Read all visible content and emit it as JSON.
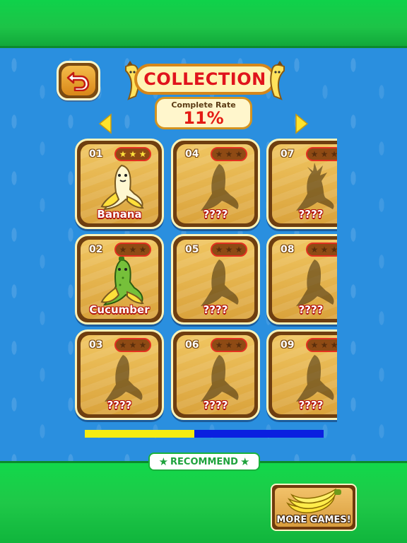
{
  "header": {
    "title": "COLLECTION",
    "back_icon": "back-arrow-icon"
  },
  "complete_rate": {
    "label": "Complete Rate",
    "value": "11%"
  },
  "navigation": {
    "prev_icon": "triangle-left-icon",
    "next_icon": "triangle-right-icon"
  },
  "collection": {
    "items": [
      {
        "number": "01",
        "name": "Banana",
        "stars": 3,
        "unlocked": true,
        "icon": "banana-icon"
      },
      {
        "number": "02",
        "name": "Cucumber",
        "stars": 0,
        "unlocked": true,
        "icon": "cucumber-banana-icon"
      },
      {
        "number": "03",
        "name": "????",
        "stars": 0,
        "unlocked": false,
        "icon": "banana-silhouette-icon"
      },
      {
        "number": "04",
        "name": "????",
        "stars": 0,
        "unlocked": false,
        "icon": "banana-silhouette-icon"
      },
      {
        "number": "05",
        "name": "????",
        "stars": 0,
        "unlocked": false,
        "icon": "banana-silhouette-icon"
      },
      {
        "number": "06",
        "name": "????",
        "stars": 0,
        "unlocked": false,
        "icon": "banana-silhouette-icon"
      },
      {
        "number": "07",
        "name": "????",
        "stars": 0,
        "unlocked": false,
        "icon": "pineapple-banana-silhouette-icon"
      },
      {
        "number": "08",
        "name": "????",
        "stars": 0,
        "unlocked": false,
        "icon": "banana-silhouette-icon"
      },
      {
        "number": "09",
        "name": "????",
        "stars": 0,
        "unlocked": false,
        "icon": "banana-silhouette-icon"
      }
    ]
  },
  "scroll_progress": 0.46,
  "footer": {
    "recommend_label": "RECOMMEND",
    "more_games_label": "MORE GAMES!",
    "more_games_icon": "banana-bunch-icon"
  },
  "colors": {
    "top_bar": "#1dc347",
    "sea": "#2a8fdf",
    "title_red": "#e0141c",
    "progress_fill": "#f6ec10",
    "progress_track": "#0a1fe0"
  }
}
